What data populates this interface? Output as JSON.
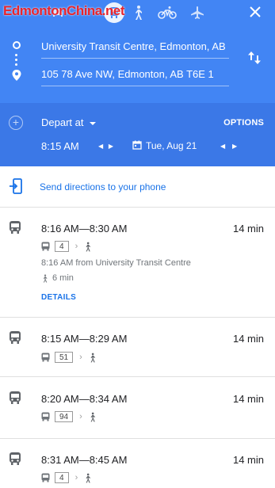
{
  "watermark": "EdmontonChina.net",
  "directions": {
    "origin": "University Transit Centre, Edmonton, AB",
    "destination": "105 78 Ave NW, Edmonton, AB T6E 1",
    "depart_label": "Depart at",
    "options_label": "OPTIONS",
    "time": "8:15 AM",
    "date": "Tue, Aug 21"
  },
  "send": {
    "label": "Send directions to your phone"
  },
  "results": [
    {
      "time_range": "8:16 AM—8:30 AM",
      "duration": "14 min",
      "route": "4",
      "from": "8:16 AM from University Transit Centre",
      "walk": "6 min",
      "details_label": "DETAILS"
    },
    {
      "time_range": "8:15 AM—8:29 AM",
      "duration": "14 min",
      "route": "51"
    },
    {
      "time_range": "8:20 AM—8:34 AM",
      "duration": "14 min",
      "route": "94"
    },
    {
      "time_range": "8:31 AM—8:45 AM",
      "duration": "14 min",
      "route": "4"
    }
  ],
  "colors": {
    "header": "#4285f4",
    "header_dark": "#3b78e7",
    "link": "#1a73e8",
    "watermark": "#e8242c"
  },
  "icons": {
    "modes": [
      "car-icon",
      "transit-icon",
      "walk-icon",
      "bike-icon",
      "flight-icon"
    ],
    "close": "close-icon",
    "swap": "swap-icon",
    "calendar": "calendar-icon",
    "send": "send-to-phone-icon",
    "bus": "bus-icon"
  }
}
